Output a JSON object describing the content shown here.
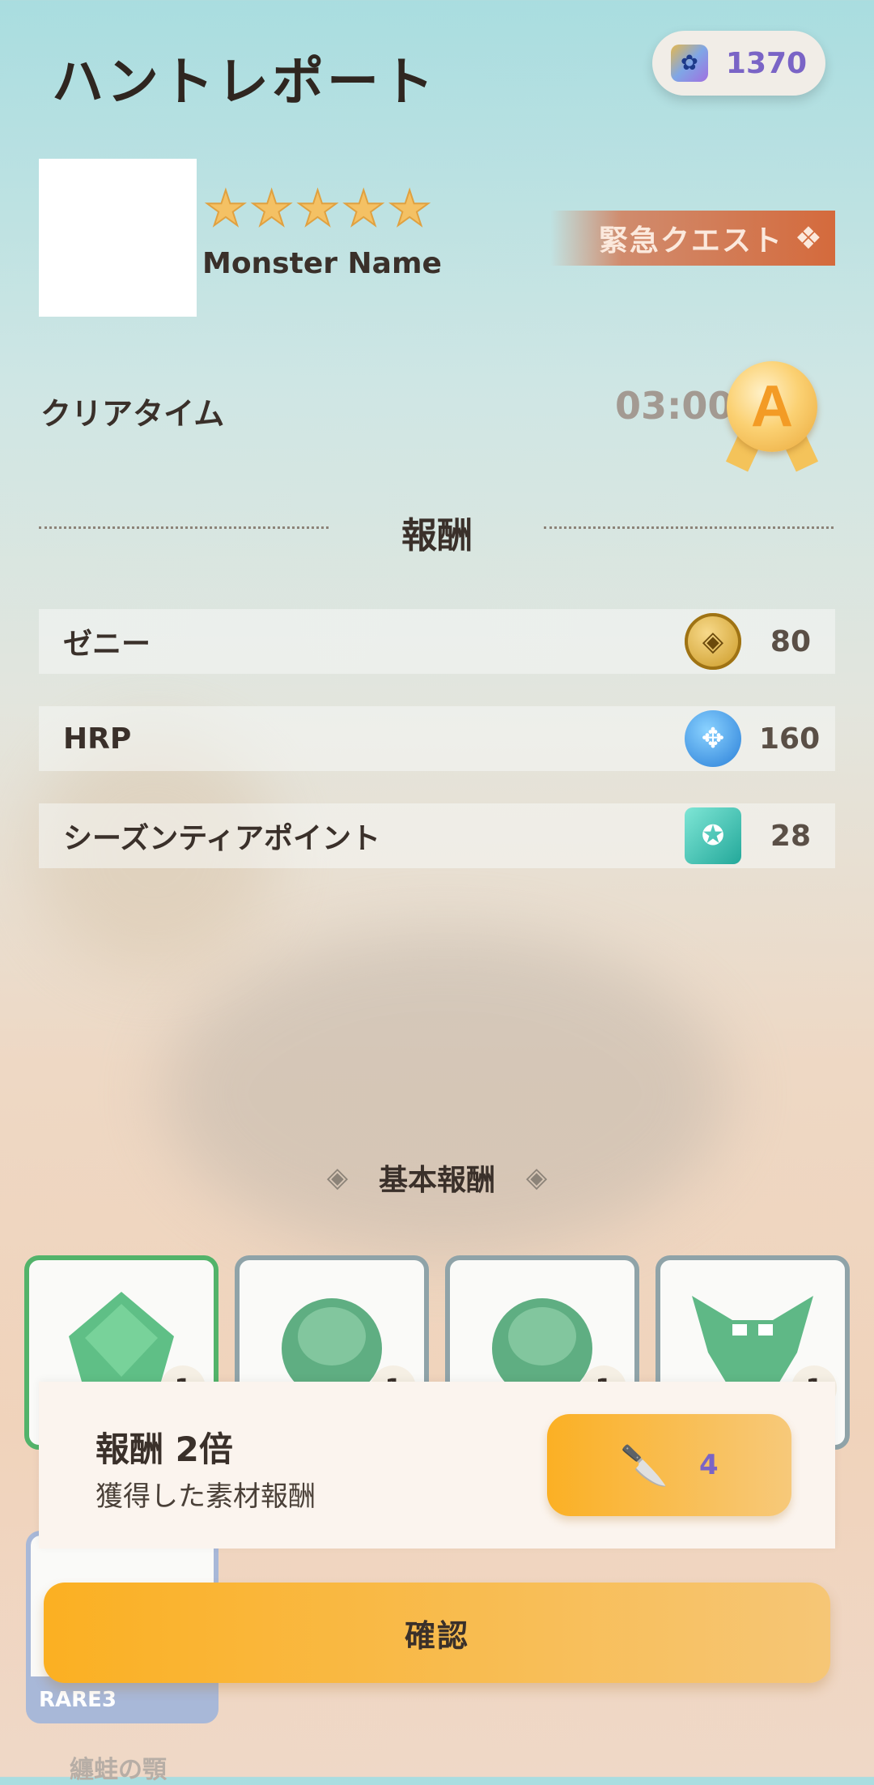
{
  "header": {
    "title": "ハントレポート",
    "currency_value": "1370",
    "currency_icon": "paw-gem-icon"
  },
  "monster": {
    "name": "Monster Name",
    "stars": 5,
    "quest_tag": "緊急クエスト"
  },
  "clear": {
    "label": "クリアタイム",
    "time": "03:00",
    "rank": "A"
  },
  "rewards": {
    "title": "報酬",
    "items": [
      {
        "label": "ゼニー",
        "icon": "zenny-coin-icon",
        "value": "80"
      },
      {
        "label": "HRP",
        "icon": "hrp-icon",
        "value": "160"
      },
      {
        "label": "シーズンティアポイント",
        "icon": "season-point-icon",
        "value": "28"
      }
    ]
  },
  "basic_rewards": {
    "title": "基本報酬",
    "cards": [
      {
        "icon": "green-crystal-icon",
        "count": "1"
      },
      {
        "icon": "green-orb-icon",
        "count": "1"
      },
      {
        "icon": "green-orb-icon",
        "count": "1"
      },
      {
        "icon": "green-monster-part-icon",
        "count": "1"
      }
    ],
    "extra_card_rarity": "RARE3",
    "extra_card_name": "纏蛙の顎"
  },
  "double_reward": {
    "title": "報酬 2倍",
    "subtitle": "獲得した素材報酬",
    "cost": "4",
    "cost_icon": "knife-icon"
  },
  "confirm_label": "確認",
  "colors": {
    "accent_orange": "#fbb024",
    "currency_purple": "#7a64c6",
    "quest_banner": "#d46a3c",
    "selected_green": "#52b36a"
  }
}
